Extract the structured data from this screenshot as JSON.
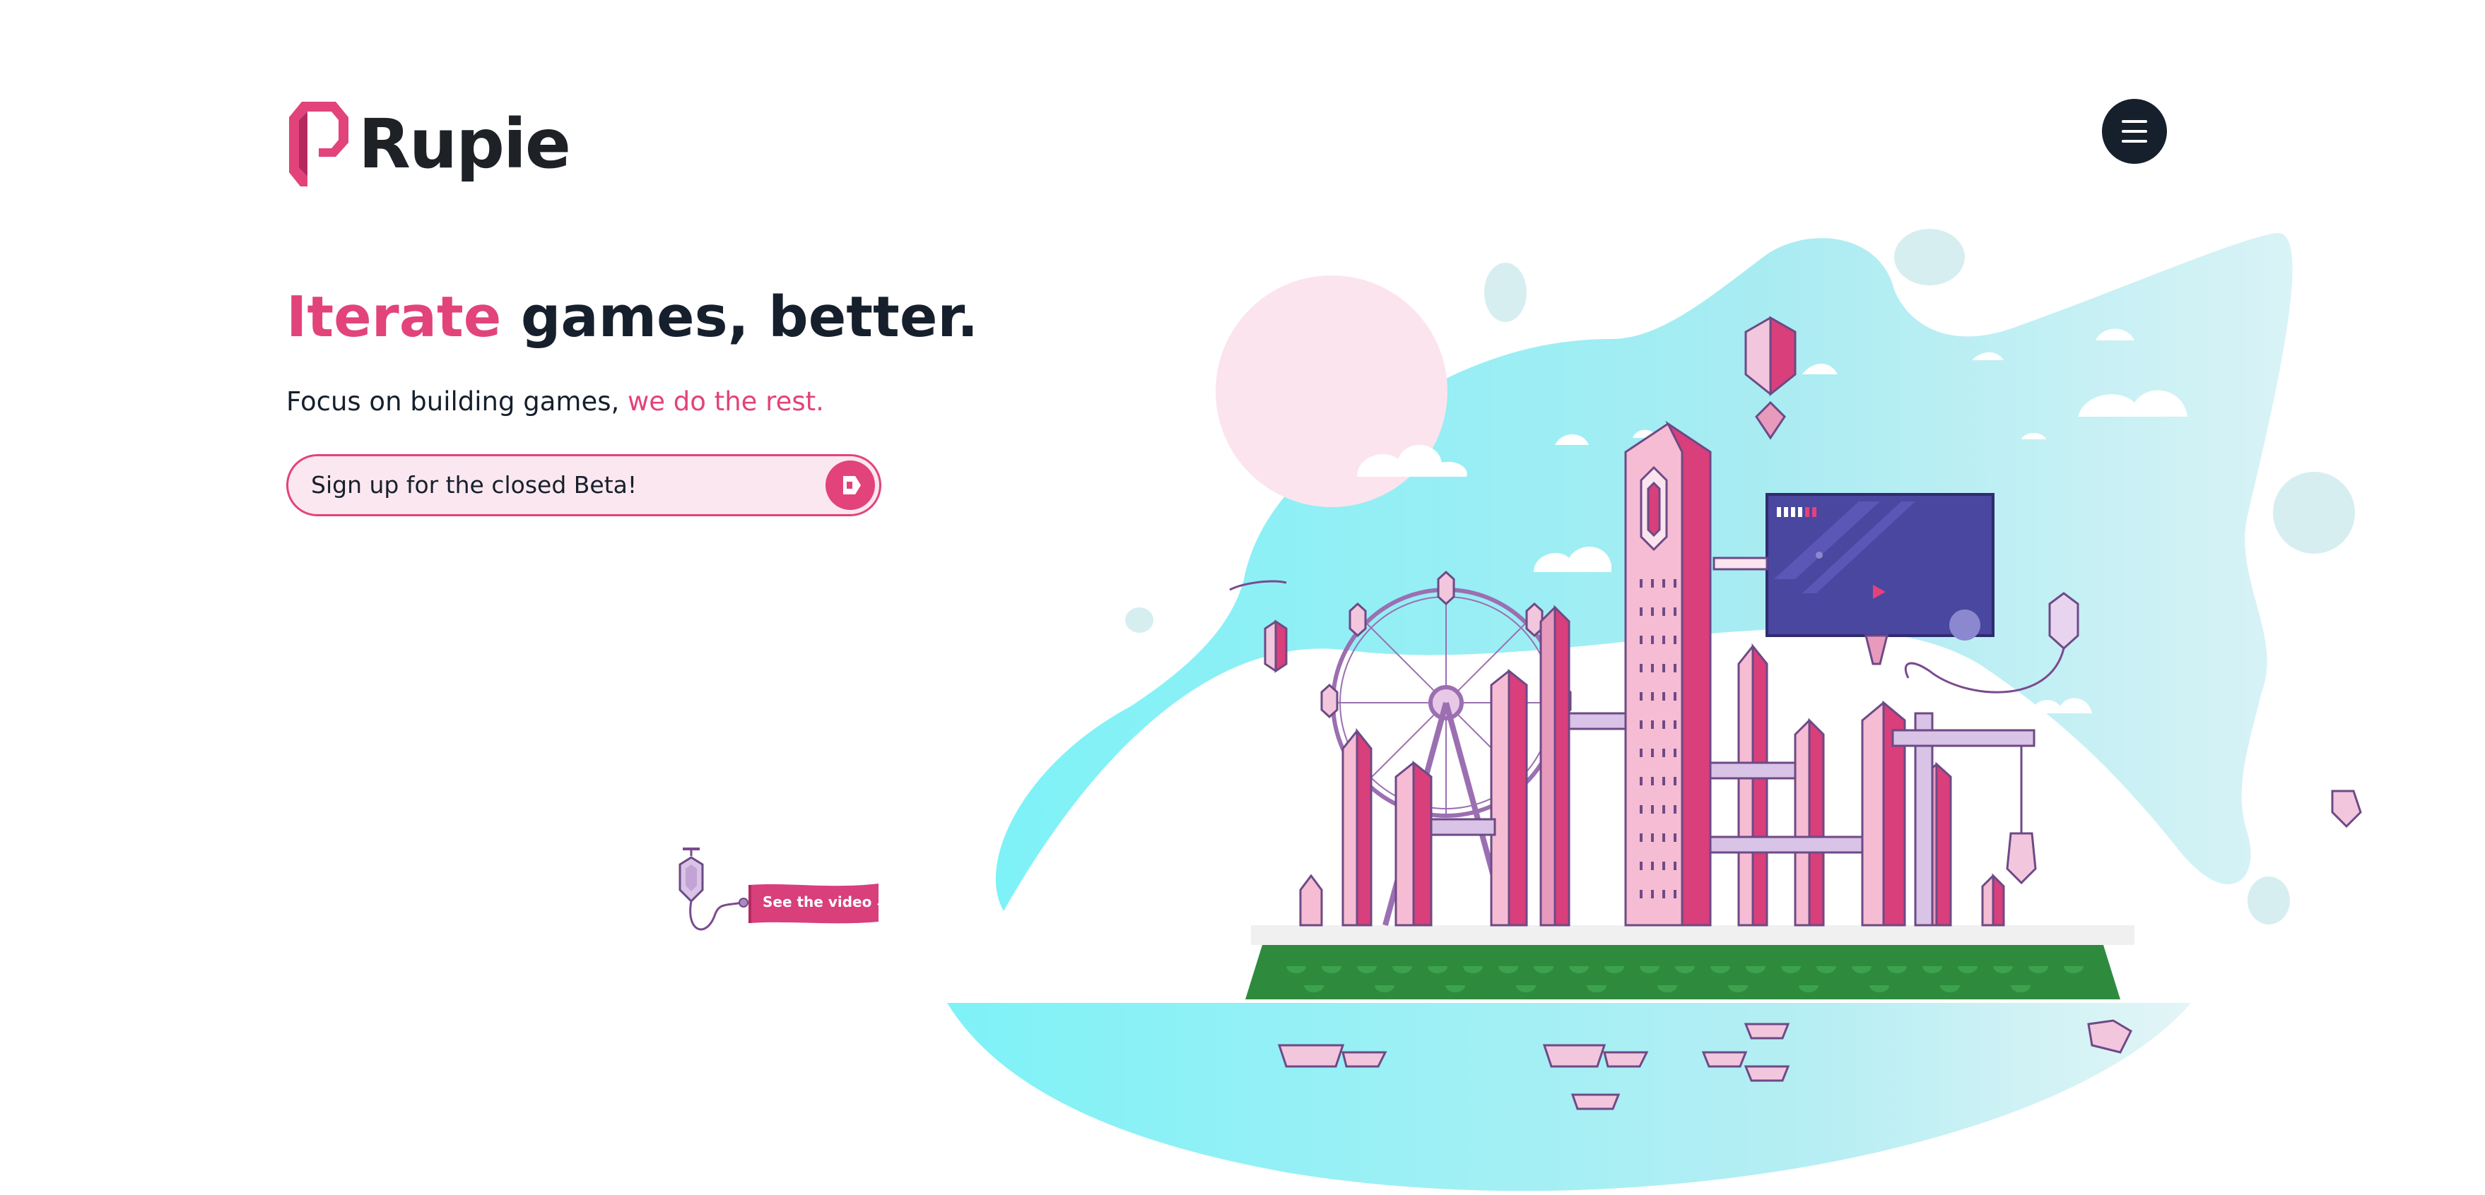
{
  "brand": {
    "name": "Rupie",
    "accent_color": "#e2437a",
    "dark_color": "#16202c",
    "logo_icon": "rupie-gem-icon"
  },
  "header": {
    "menu_icon": "hamburger-menu-icon"
  },
  "hero": {
    "title_accent": "Iterate",
    "title_rest": "games, better.",
    "subtitle_prefix": "Focus on building games,",
    "subtitle_accent": "we do the rest."
  },
  "signup": {
    "label": "Sign up for the closed Beta!",
    "go_icon": "rupie-arrow-icon"
  },
  "video_cta": {
    "label": "See the video",
    "arrow": "↓",
    "icon": "down-arrow-icon"
  },
  "illustration": {
    "name": "crystal-city-island",
    "palette": {
      "sky": "#7ff1f6",
      "sky_light": "#d9f3f6",
      "sun": "#fbe4ee",
      "grass": "#2e8b3e",
      "tower_light": "#f6bcd3",
      "tower_dark": "#d83f7b",
      "screen": "#4a47a0"
    }
  }
}
